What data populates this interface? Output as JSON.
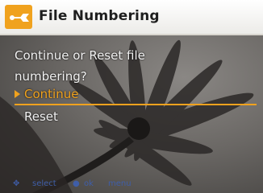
{
  "header": {
    "title": "File Numbering",
    "icon": "wrench-icon",
    "accent_color": "#f0a21e"
  },
  "dialog": {
    "question_line1": "Continue or Reset file",
    "question_line2": "numbering?"
  },
  "menu": {
    "items": [
      {
        "label": "Continue",
        "selected": true
      },
      {
        "label": "Reset",
        "selected": false
      }
    ]
  },
  "footer": {
    "select_label": "select",
    "ok_label": "ok",
    "menu_label": "menu"
  }
}
